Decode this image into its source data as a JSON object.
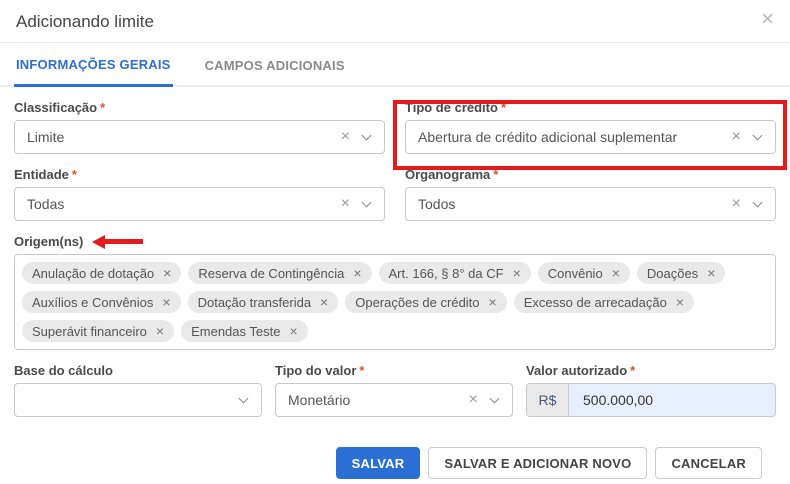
{
  "modal": {
    "title": "Adicionando limite"
  },
  "ui": {
    "required_marker": "*"
  },
  "icons": {
    "close": "×",
    "clear": "×",
    "chip_remove": "×"
  },
  "tabs": [
    {
      "label": "INFORMAÇÕES GERAIS",
      "active": true
    },
    {
      "label": "CAMPOS ADICIONAIS",
      "active": false
    }
  ],
  "fields": {
    "classificacao": {
      "label": "Classificação",
      "required": true,
      "value": "Limite"
    },
    "tipo_credito": {
      "label": "Tipo de crédito",
      "required": true,
      "value": "Abertura de crédito adicional suplementar",
      "highlighted": true
    },
    "entidade": {
      "label": "Entidade",
      "required": true,
      "value": "Todas"
    },
    "organograma": {
      "label": "Organograma",
      "required": true,
      "value": "Todos"
    },
    "origens": {
      "label": "Origem(ns)",
      "tags": [
        "Anulação de dotação",
        "Reserva de Contingência",
        "Art. 166, § 8° da CF",
        "Convênio",
        "Doações",
        "Auxílios e Convênios",
        "Dotação transferida",
        "Operações de crédito",
        "Excesso de arrecadação",
        "Superávit financeiro",
        "Emendas Teste"
      ]
    },
    "base_calculo": {
      "label": "Base do cálculo",
      "required": false,
      "value": ""
    },
    "tipo_valor": {
      "label": "Tipo do valor",
      "required": true,
      "value": "Monetário"
    },
    "valor_autorizado": {
      "label": "Valor autorizado",
      "required": true,
      "prefix": "R$",
      "value": "500.000,00"
    }
  },
  "buttons": {
    "salvar": "SALVAR",
    "salvar_adicionar": "SALVAR E ADICIONAR NOVO",
    "cancelar": "CANCELAR"
  },
  "colors": {
    "accent": "#2b6fd4",
    "required": "#e2512b",
    "annotation": "#e41a1c",
    "money_bg": "#e8effc"
  }
}
